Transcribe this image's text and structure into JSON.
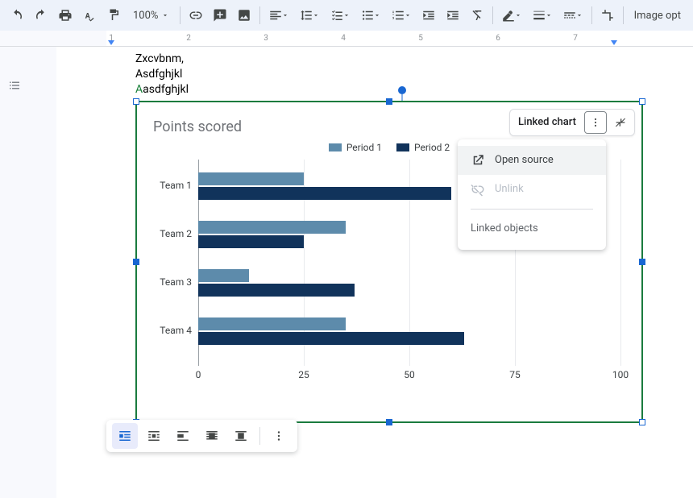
{
  "toolbar": {
    "zoom": "100%",
    "image_options": "Image opt"
  },
  "ruler": {
    "labels": [
      "1",
      "2",
      "3",
      "4",
      "5",
      "6",
      "7"
    ]
  },
  "doc_text": {
    "line1": "Zxcvbnm,",
    "line2": "Asdfghjkl",
    "line3_prefix": "A",
    "line3_rest": "asdfghjkl"
  },
  "chip": {
    "label": "Linked chart"
  },
  "menu": {
    "open_source": "Open source",
    "unlink": "Unlink",
    "linked_objects": "Linked objects"
  },
  "chart": {
    "title": "Points scored",
    "legend": {
      "p1": "Period 1",
      "p2": "Period 2"
    },
    "xticks": [
      "0",
      "25",
      "50",
      "75",
      "100"
    ],
    "categories": [
      "Team 1",
      "Team 2",
      "Team 3",
      "Team 4"
    ]
  },
  "chart_data": {
    "type": "bar",
    "orientation": "horizontal",
    "title": "Points scored",
    "xlabel": "",
    "ylabel": "",
    "xlim": [
      0,
      100
    ],
    "categories": [
      "Team 1",
      "Team 2",
      "Team 3",
      "Team 4"
    ],
    "series": [
      {
        "name": "Period 1",
        "color": "#5d8bab",
        "values": [
          25,
          35,
          12,
          35
        ]
      },
      {
        "name": "Period 2",
        "color": "#11335b",
        "values": [
          60,
          25,
          37,
          63
        ]
      }
    ],
    "legend_position": "top"
  }
}
